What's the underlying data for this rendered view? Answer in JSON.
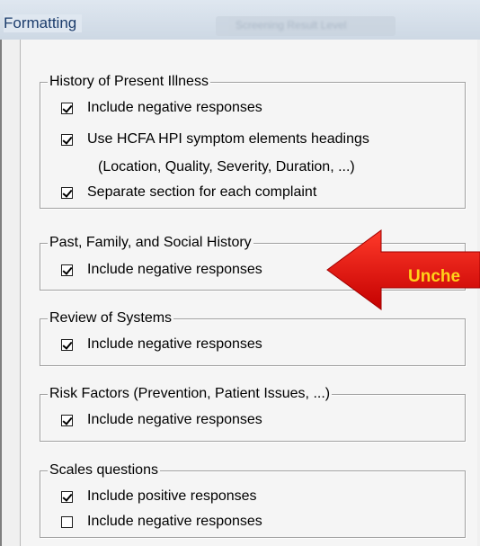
{
  "window": {
    "title": "Formatting",
    "background_tab": "Screening Result Level"
  },
  "sections": [
    {
      "legend": "History of Present Illness",
      "items": [
        {
          "label": "Include negative responses",
          "checked": true
        },
        {
          "label": "Use HCFA HPI symptom elements headings",
          "checked": true
        },
        {
          "label": "Separate section for each complaint",
          "checked": true
        }
      ],
      "note": "(Location, Quality, Severity, Duration, ...)"
    },
    {
      "legend": "Past, Family, and Social History",
      "items": [
        {
          "label": "Include negative responses",
          "checked": true
        }
      ]
    },
    {
      "legend": "Review of Systems",
      "items": [
        {
          "label": "Include negative responses",
          "checked": true
        }
      ]
    },
    {
      "legend": "Risk Factors (Prevention, Patient Issues, ...)",
      "items": [
        {
          "label": "Include negative responses",
          "checked": true
        }
      ]
    },
    {
      "legend": "Scales questions",
      "items": [
        {
          "label": "Include positive responses",
          "checked": true
        },
        {
          "label": "Include negative responses",
          "checked": false
        }
      ]
    }
  ],
  "callout": {
    "text": "Unche",
    "color": "#e8100c",
    "text_color": "#ffd21a"
  }
}
